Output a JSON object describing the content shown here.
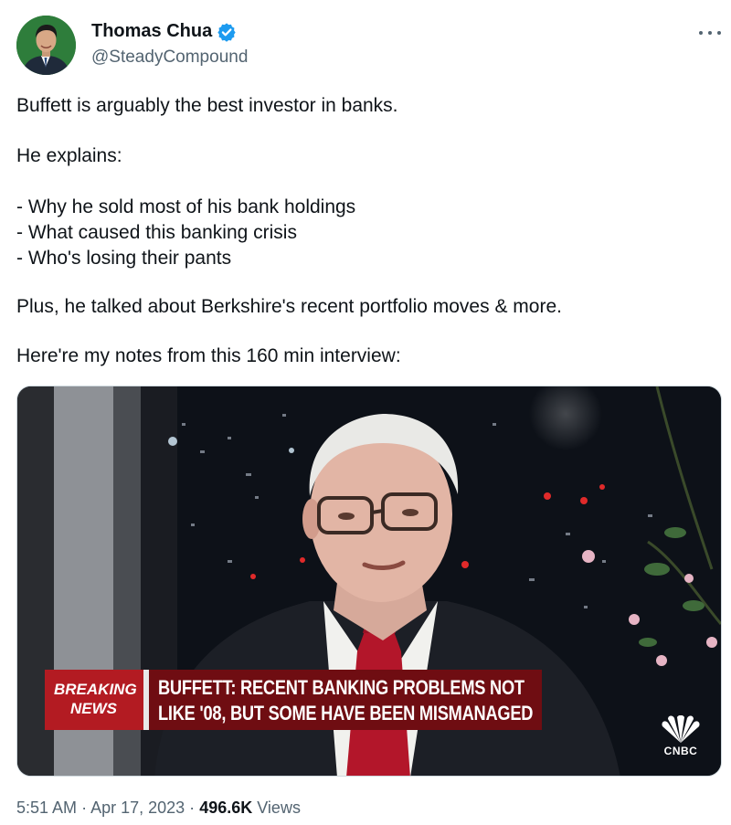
{
  "author": {
    "display_name": "Thomas Chua",
    "handle": "@SteadyCompound",
    "verified": true,
    "avatar_icon": "profile-photo"
  },
  "menu_icon": "more-dots-icon",
  "tweet": {
    "paragraphs": [
      "Buffett is arguably the best investor in banks.",
      "He explains:",
      "- Why he sold most of his bank holdings\n- What caused this banking crisis\n- Who's losing their pants",
      "Plus, he talked about Berkshire's recent portfolio moves & more.",
      "Here're my notes from this 160 min interview:"
    ]
  },
  "media": {
    "chyron_label_line1": "BREAKING",
    "chyron_label_line2": "NEWS",
    "headline_line1": "BUFFETT: RECENT BANKING PROBLEMS NOT",
    "headline_line2": "LIKE '08, BUT SOME HAVE BEEN MISMANAGED",
    "network_logo_text": "CNBC"
  },
  "meta": {
    "time": "5:51 AM",
    "separator": "·",
    "date": "Apr 17, 2023",
    "views_count": "496.6K",
    "views_label": "Views"
  },
  "colors": {
    "verified_blue": "#1d9bf0",
    "breaking_red": "#b31b22",
    "headline_maroon": "#6f0d12",
    "muted_text": "#536471"
  }
}
